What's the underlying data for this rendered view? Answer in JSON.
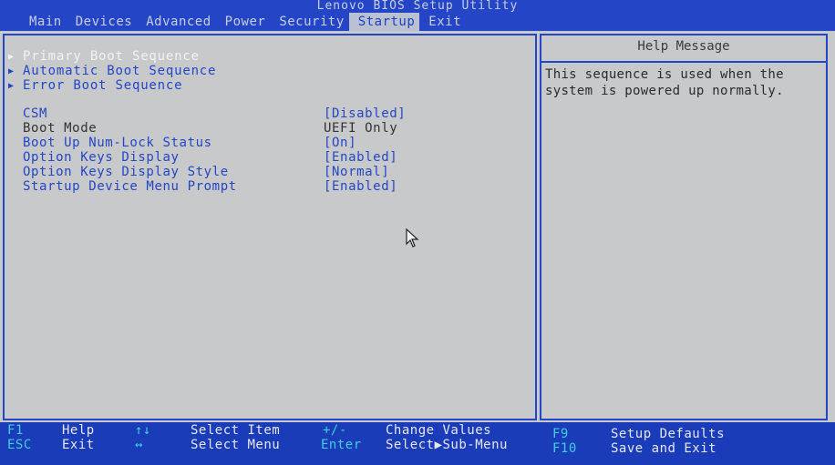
{
  "title": "Lenovo BIOS Setup Utility",
  "menu": [
    {
      "label": "Main"
    },
    {
      "label": "Devices"
    },
    {
      "label": "Advanced"
    },
    {
      "label": "Power"
    },
    {
      "label": "Security"
    },
    {
      "label": "Startup",
      "active": true
    },
    {
      "label": "Exit"
    }
  ],
  "submenus": [
    {
      "label": "Primary Boot Sequence",
      "selected": true
    },
    {
      "label": "Automatic Boot Sequence"
    },
    {
      "label": "Error Boot Sequence"
    }
  ],
  "settings": [
    {
      "name": "CSM",
      "value": "[Disabled]"
    },
    {
      "name": "Boot Mode",
      "value": "UEFI Only",
      "static": true
    },
    {
      "name": "Boot Up Num-Lock Status",
      "value": "[On]"
    },
    {
      "name": "Option Keys Display",
      "value": "[Enabled]"
    },
    {
      "name": "Option Keys Display Style",
      "value": "[Normal]"
    },
    {
      "name": "Startup Device Menu Prompt",
      "value": "[Enabled]"
    }
  ],
  "help": {
    "title": "Help Message",
    "lines": [
      "This sequence is used when the",
      "system is powered up normally."
    ]
  },
  "footer": {
    "f1_key": "F1",
    "f1_desc": "Help",
    "esc_key": "ESC",
    "esc_desc": "Exit",
    "updown_key": "↑↓",
    "updown_desc": "Select Item",
    "leftright_key": "↔",
    "leftright_desc": "Select Menu",
    "plusminus_key": "+/-",
    "plusminus_desc": "Change Values",
    "enter_key": "Enter",
    "enter_desc": "Select▶Sub-Menu",
    "f9_key": "F9",
    "f9_desc": "Setup Defaults",
    "f10_key": "F10",
    "f10_desc": "Save and Exit"
  },
  "colors": {
    "bios_blue": "#2446c6",
    "panel_gray": "#c7c9cb",
    "key_cyan": "#3fd0e0"
  }
}
